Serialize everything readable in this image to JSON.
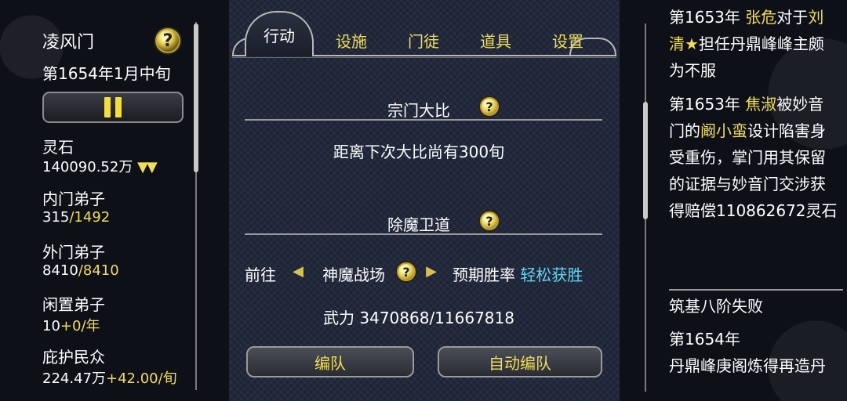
{
  "left": {
    "sect_name": "凌风门",
    "date": "第1654年1月中旬",
    "stats": [
      {
        "label": "灵石",
        "value": "140090.52万",
        "extra": "▼▼"
      },
      {
        "label": "内门弟子",
        "value": "315",
        "extra": "/1492"
      },
      {
        "label": "外门弟子",
        "value": "8410",
        "extra": "/8410"
      },
      {
        "label": "闲置弟子",
        "value": "10",
        "extra": "+0/年"
      },
      {
        "label": "庇护民众",
        "value": "224.47万",
        "extra": "+42.00/旬"
      }
    ]
  },
  "tabs": [
    "行动",
    "设施",
    "门徒",
    "道具",
    "设置"
  ],
  "center": {
    "section1_title": "宗门大比",
    "section1_text": "距离下次大比尚有300旬",
    "section2_title": "除魔卫道",
    "goto_label": "前往",
    "location": "神魔战场",
    "expected_label": "预期胜率",
    "expected_value": "轻松获胜",
    "power_text": "武力 3470868/11667818",
    "btn_formation": "编队",
    "btn_auto_formation": "自动编队"
  },
  "help_label": "?",
  "log": {
    "entry1_year": "第1653年",
    "entry1_person1": "张危",
    "entry1_mid": "对于",
    "entry1_person2": "刘清★",
    "entry1_tail": "担任丹鼎峰峰主颇为不服",
    "entry2_year": "第1653年",
    "entry2_person1": "焦淑",
    "entry2_mid": "被妙音门的",
    "entry2_person2": "阚小蛮",
    "entry2_tail": "设计陷害身受重伤，掌门用其保留的证据与妙音门交涉获得赔偿110862672灵石",
    "entry3_text": "筑基八阶失败",
    "entry4_year": "第1654年",
    "entry4_text": "丹鼎峰庚阁炼得再造丹"
  },
  "colors": {
    "highlight": "#f1dd5b",
    "cyan": "#5fd6f2",
    "panel": "#1e2437"
  }
}
